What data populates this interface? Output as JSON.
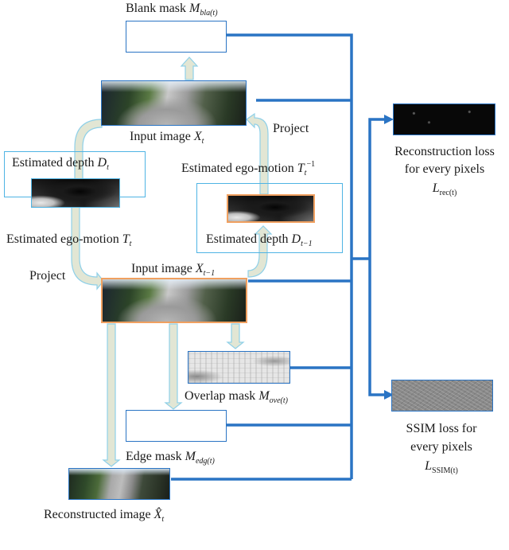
{
  "diagram": {
    "nodes": {
      "blank_mask": {
        "label": "Blank mask ",
        "symbol": "M",
        "subscript": "bla(t)"
      },
      "input_t": {
        "label": "Input image ",
        "symbol": "X",
        "subscript": "t"
      },
      "depth_t": {
        "label": "Estimated depth ",
        "symbol": "D",
        "subscript": "t"
      },
      "ego_inverse": {
        "label": "Estimated ego-motion ",
        "symbol": "T",
        "subscript": "t",
        "superscript": "−1"
      },
      "ego_t": {
        "label": "Estimated ego-motion ",
        "symbol": "T",
        "subscript": "t"
      },
      "depth_t1": {
        "label": "Estimated depth ",
        "symbol": "D",
        "subscript": "t−1"
      },
      "input_t1": {
        "label": "Input image ",
        "symbol": "X",
        "subscript": "t−1"
      },
      "overlap_mask": {
        "label": "Overlap mask  ",
        "symbol": "M",
        "subscript": "ove(t)"
      },
      "edge_mask": {
        "label": "Edge mask  ",
        "symbol": "M",
        "subscript": "edg(t)"
      },
      "reconstructed": {
        "label": "Reconstructed image  ",
        "symbol": "X̂",
        "subscript": "t"
      },
      "rec_loss": {
        "line1": "Reconstruction loss",
        "line2": "for every pixels",
        "symbol": "L",
        "subscript": "rec(t)"
      },
      "ssim_loss": {
        "line1": "SSIM loss for",
        "line2": "every pixels",
        "symbol": "L",
        "subscript": "SSIM(t)"
      }
    },
    "edge_labels": {
      "project_right": "Project",
      "project_left": "Project"
    },
    "colors": {
      "connector_blue": "#2a74c4",
      "frame_cyan": "#4fb4e4",
      "frame_orange": "#f0a060",
      "arrow_fill": "#e2e6d4",
      "arrow_stroke": "#8fd0e8"
    }
  }
}
